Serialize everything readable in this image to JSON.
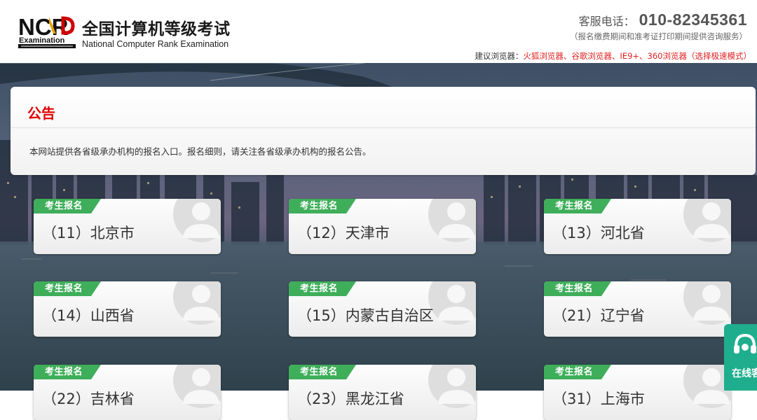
{
  "header": {
    "logo_text": "NCR",
    "logo_sub": "Examination",
    "title_cn": "全国计算机等级考试",
    "title_en": "National Computer Rank Examination",
    "hotline_label": "客服电话：",
    "hotline_number": "010-82345361",
    "hotline_note": "（报名缴费期间和准考证打印期间提供咨询服务）",
    "browser_tip_label": "建议浏览器：",
    "browser_tip_list": "火狐浏览器、谷歌浏览器、IE9+、360浏览器（选择极速模式）"
  },
  "notice": {
    "title": "公告",
    "text": "本网站提供各省级承办机构的报名入口。报名细则，请关注各省级承办机构的报名公告。"
  },
  "cards": [
    {
      "badge": "考生报名",
      "name": "（11）北京市"
    },
    {
      "badge": "考生报名",
      "name": "（12）天津市"
    },
    {
      "badge": "考生报名",
      "name": "（13）河北省"
    },
    {
      "badge": "考生报名",
      "name": "（14）山西省"
    },
    {
      "badge": "考生报名",
      "name": "（15）内蒙古自治区"
    },
    {
      "badge": "考生报名",
      "name": "（21）辽宁省"
    },
    {
      "badge": "考生报名",
      "name": "（22）吉林省"
    },
    {
      "badge": "考生报名",
      "name": "（23）黑龙江省"
    },
    {
      "badge": "考生报名",
      "name": "（31）上海市"
    }
  ],
  "service": {
    "label": "在线客服"
  },
  "colors": {
    "accent_red": "#e00000",
    "badge_green": "#3fae5a",
    "service_teal": "#1fae8d"
  }
}
